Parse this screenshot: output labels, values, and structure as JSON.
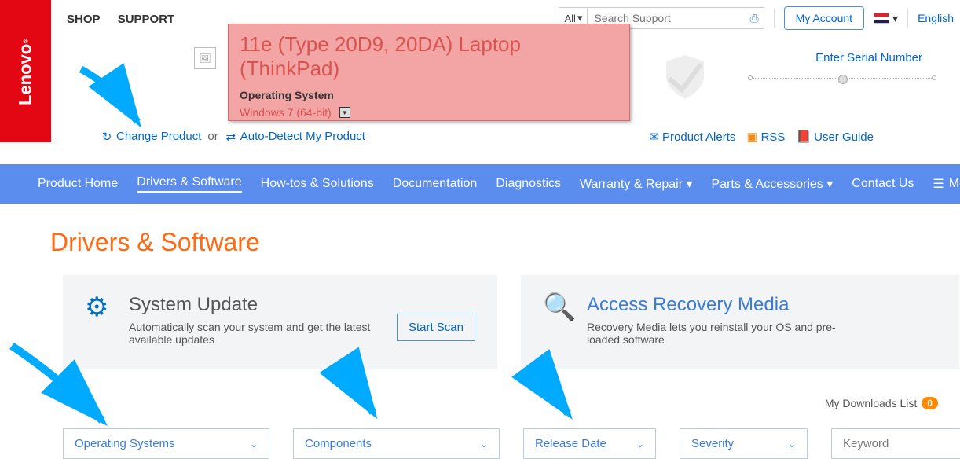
{
  "brand": "Lenovo",
  "topnav": {
    "shop": "SHOP",
    "support": "SUPPORT"
  },
  "search": {
    "all": "All",
    "placeholder": "Search Support"
  },
  "my_account": "My Account",
  "language": "English",
  "product": {
    "title": "11e (Type 20D9, 20DA) Laptop (ThinkPad)",
    "os_label": "Operating System",
    "os_value": "Windows 7 (64-bit)"
  },
  "change_product": "Change Product",
  "or": "or",
  "auto_detect": "Auto-Detect My Product",
  "serial_label": "Enter Serial Number",
  "links": {
    "alerts": "Product  Alerts",
    "rss": "RSS",
    "guide": "User Guide"
  },
  "nav": {
    "home": "Product Home",
    "drivers": "Drivers & Software",
    "howto": "How-tos & Solutions",
    "docs": "Documentation",
    "diag": "Diagnostics",
    "warranty": "Warranty & Repair",
    "parts": "Parts & Accessories",
    "contact": "Contact Us",
    "more": "More"
  },
  "page_title": "Drivers & Software",
  "cards": {
    "update": {
      "title": "System Update",
      "desc": "Automatically scan your system and get the latest available updates",
      "button": "Start Scan"
    },
    "recovery": {
      "title": "Access Recovery Media",
      "desc": "Recovery Media lets you reinstall your OS and pre-loaded software"
    }
  },
  "downloads_list": {
    "label": "My Downloads List",
    "count": "0"
  },
  "filters": {
    "os": "Operating Systems",
    "comp": "Components",
    "date": "Release Date",
    "sev": "Severity",
    "key_placeholder": "Keyword"
  }
}
